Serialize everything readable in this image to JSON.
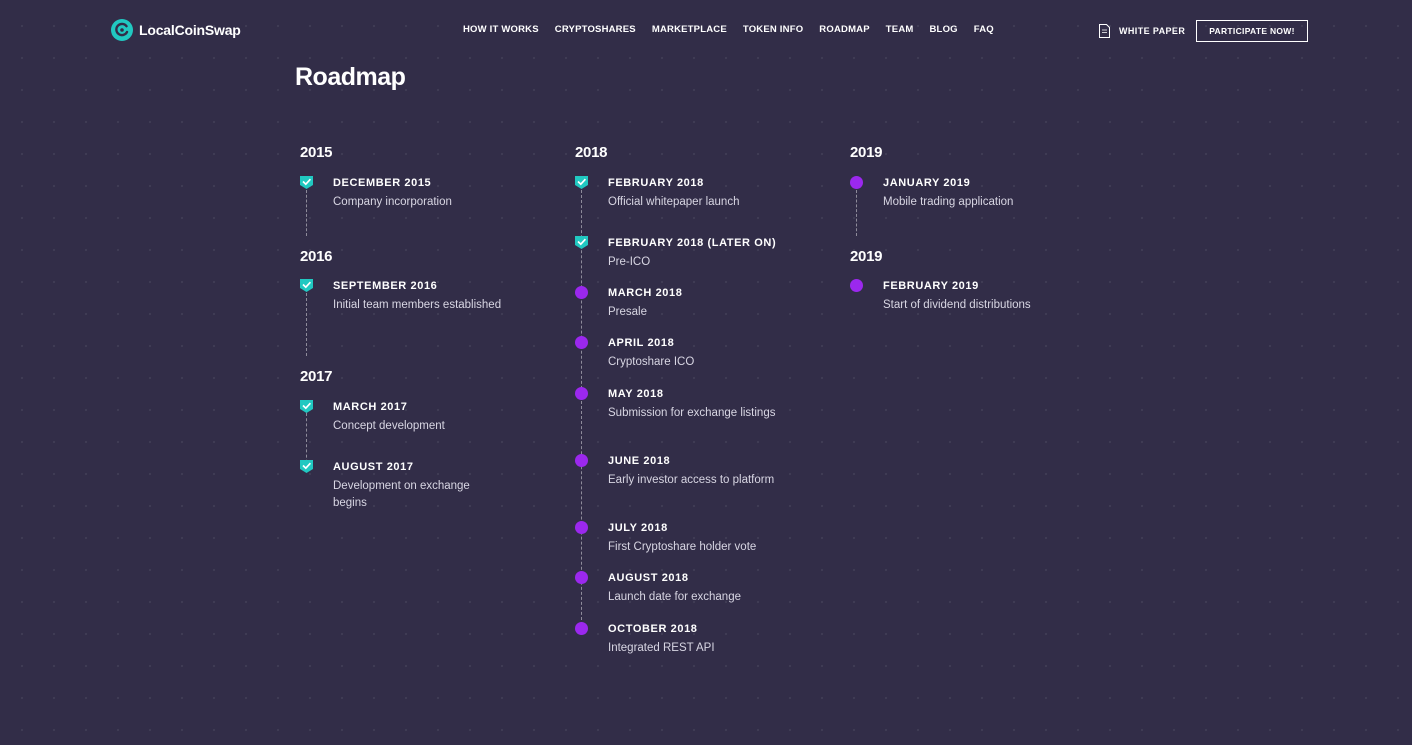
{
  "header": {
    "logo_text": "LocalCoinSwap",
    "nav": [
      "HOW IT WORKS",
      "CRYPTOSHARES",
      "MARKETPLACE",
      "TOKEN INFO",
      "ROADMAP",
      "TEAM",
      "BLOG",
      "FAQ"
    ],
    "white_paper": "WHITE PAPER",
    "cta": "PARTICIPATE NOW!"
  },
  "page": {
    "title": "Roadmap"
  },
  "colors": {
    "background": "#322d48",
    "done": "#21c8c1",
    "pending": "#9b28ee"
  },
  "roadmap": {
    "col1": {
      "groups": [
        {
          "year": "2015",
          "items": [
            {
              "date": "DECEMBER 2015",
              "desc": "Company incorporation",
              "status": "done"
            }
          ]
        },
        {
          "year": "2016",
          "items": [
            {
              "date": "SEPTEMBER 2016",
              "desc": "Initial team members established",
              "status": "done"
            }
          ]
        },
        {
          "year": "2017",
          "items": [
            {
              "date": "MARCH 2017",
              "desc": "Concept development",
              "status": "done"
            },
            {
              "date": "AUGUST 2017",
              "desc": "Development on exchange begins",
              "status": "done"
            }
          ]
        }
      ]
    },
    "col2": {
      "groups": [
        {
          "year": "2018",
          "items": [
            {
              "date": "FEBRUARY 2018",
              "desc": "Official whitepaper launch",
              "status": "done"
            },
            {
              "date": "FEBRUARY 2018 (LATER ON)",
              "desc": "Pre-ICO",
              "status": "done"
            },
            {
              "date": "MARCH 2018",
              "desc": "Presale",
              "status": "pending"
            },
            {
              "date": "APRIL 2018",
              "desc": "Cryptoshare ICO",
              "status": "pending"
            },
            {
              "date": "MAY 2018",
              "desc": "Submission for exchange listings",
              "status": "pending"
            },
            {
              "date": "JUNE 2018",
              "desc": "Early investor access to platform",
              "status": "pending"
            },
            {
              "date": "JULY 2018",
              "desc": "First Cryptoshare holder vote",
              "status": "pending"
            },
            {
              "date": "AUGUST 2018",
              "desc": "Launch date for exchange",
              "status": "pending"
            },
            {
              "date": "OCTOBER 2018",
              "desc": "Integrated REST API",
              "status": "pending"
            }
          ]
        }
      ]
    },
    "col3": {
      "groups": [
        {
          "year": "2019",
          "items": [
            {
              "date": "JANUARY 2019",
              "desc": "Mobile trading application",
              "status": "pending"
            }
          ]
        },
        {
          "year": "2019",
          "items": [
            {
              "date": "FEBRUARY 2019",
              "desc": "Start of dividend distributions",
              "status": "pending"
            }
          ]
        }
      ]
    }
  }
}
